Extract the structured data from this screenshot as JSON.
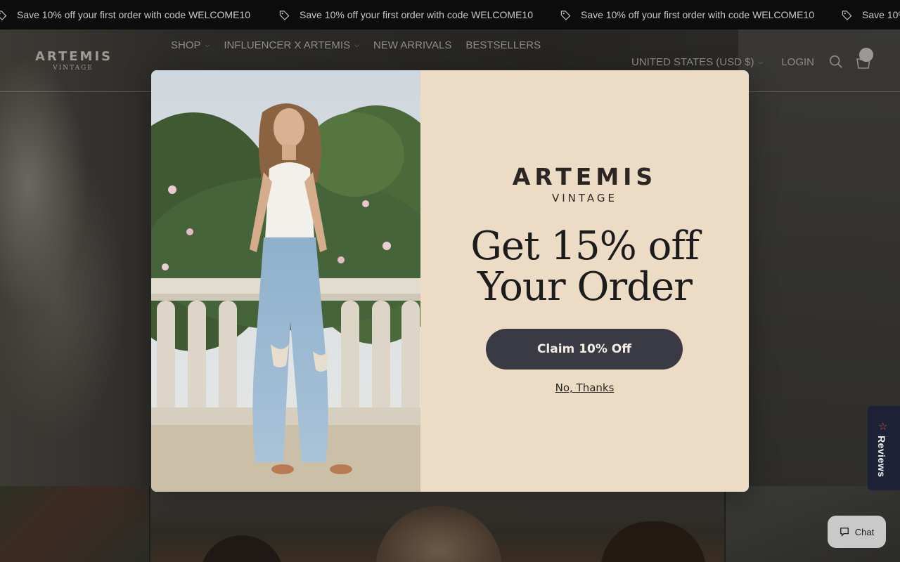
{
  "announcement": {
    "text": "Save 10% off your first order with code WELCOME10",
    "text_partial": "Save 10%",
    "icon": "tag-icon"
  },
  "header": {
    "logo_line1": "ARTEMIS",
    "logo_line2": "VINTAGE",
    "nav": [
      {
        "label": "SHOP",
        "has_dropdown": true
      },
      {
        "label": "INFLUENCER X ARTEMIS",
        "has_dropdown": true
      },
      {
        "label": "NEW ARRIVALS",
        "has_dropdown": false
      },
      {
        "label": "BESTSELLERS",
        "has_dropdown": false
      }
    ],
    "country_selector": "UNITED STATES (USD $)",
    "login": "LOGIN",
    "search_icon": "search-icon",
    "cart_icon": "cart-icon"
  },
  "modal": {
    "brand_line1": "ARTEMIS",
    "brand_line2": "VINTAGE",
    "headline_line1": "Get 15% off",
    "headline_line2": "Your Order",
    "claim_button": "Claim 10% Off",
    "decline_link": "No, Thanks",
    "colors": {
      "panel": "#ecdcc6",
      "button": "#3a3a45"
    }
  },
  "reviews_tab": {
    "label": "Reviews",
    "icon": "star-icon"
  },
  "chat": {
    "label": "Chat",
    "icon": "chat-bubble-icon"
  }
}
